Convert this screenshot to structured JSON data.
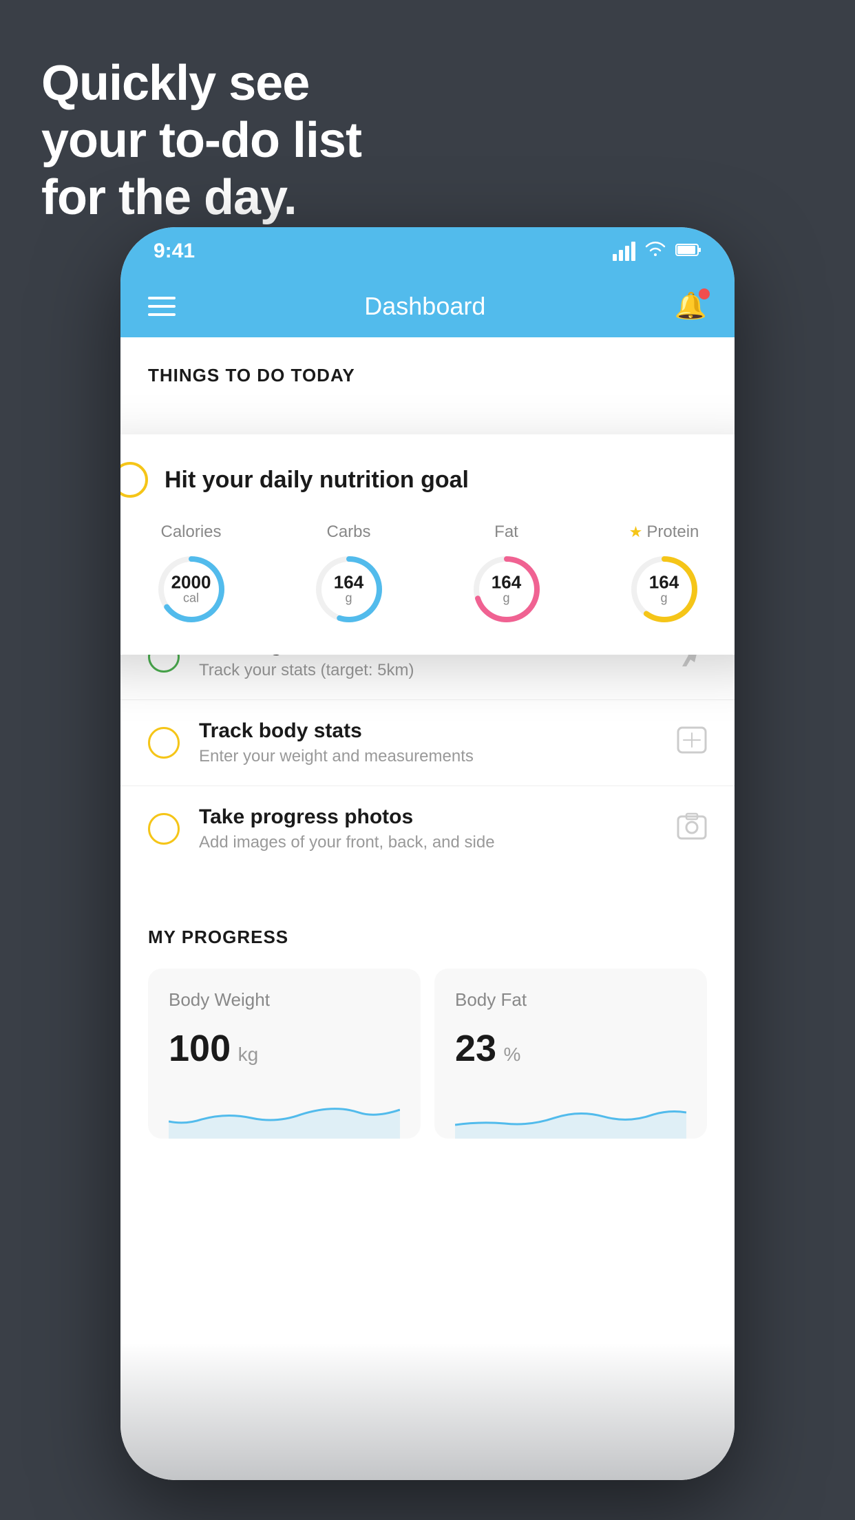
{
  "background_color": "#3a3f47",
  "hero": {
    "text_line1": "Quickly see",
    "text_line2": "your to-do list",
    "text_line3": "for the day."
  },
  "phone": {
    "status_bar": {
      "time": "9:41",
      "signal_bars": 4,
      "wifi": true,
      "battery": true
    },
    "header": {
      "title": "Dashboard",
      "menu_label": "menu",
      "notification_label": "notification"
    },
    "section_title": "THINGS TO DO TODAY",
    "floating_card": {
      "checkbox_color": "#f5c518",
      "title": "Hit your daily nutrition goal",
      "rings": [
        {
          "label": "Calories",
          "value": "2000",
          "unit": "cal",
          "color": "#52bbec",
          "percent": 65
        },
        {
          "label": "Carbs",
          "value": "164",
          "unit": "g",
          "color": "#52bbec",
          "percent": 55
        },
        {
          "label": "Fat",
          "value": "164",
          "unit": "g",
          "color": "#f06292",
          "percent": 70
        },
        {
          "label": "Protein",
          "value": "164",
          "unit": "g",
          "color": "#f5c518",
          "starred": true,
          "percent": 60
        }
      ]
    },
    "todo_items": [
      {
        "id": "running",
        "circle_color": "green",
        "title": "Running",
        "subtitle": "Track your stats (target: 5km)",
        "icon": "🏃"
      },
      {
        "id": "body-stats",
        "circle_color": "yellow",
        "title": "Track body stats",
        "subtitle": "Enter your weight and measurements",
        "icon": "⚖️"
      },
      {
        "id": "progress-photos",
        "circle_color": "yellow",
        "title": "Take progress photos",
        "subtitle": "Add images of your front, back, and side",
        "icon": "🖼️"
      }
    ],
    "progress": {
      "section_title": "MY PROGRESS",
      "cards": [
        {
          "id": "body-weight",
          "title": "Body Weight",
          "value": "100",
          "unit": "kg",
          "chart_color": "#52bbec"
        },
        {
          "id": "body-fat",
          "title": "Body Fat",
          "value": "23",
          "unit": "%",
          "chart_color": "#52bbec"
        }
      ]
    }
  }
}
